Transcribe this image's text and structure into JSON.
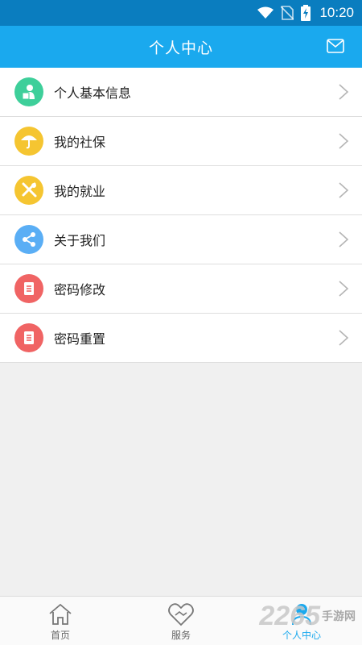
{
  "status": {
    "time": "10:20"
  },
  "header": {
    "title": "个人中心",
    "mail_icon": "mail-icon"
  },
  "menu": [
    {
      "label": "个人基本信息",
      "icon": "person-icon",
      "color": "#3ecf9a"
    },
    {
      "label": "我的社保",
      "icon": "umbrella-icon",
      "color": "#f5c531"
    },
    {
      "label": "我的就业",
      "icon": "tools-icon",
      "color": "#f5c531"
    },
    {
      "label": "关于我们",
      "icon": "share-icon",
      "color": "#5aaef5"
    },
    {
      "label": "密码修改",
      "icon": "document-icon",
      "color": "#f06464"
    },
    {
      "label": "密码重置",
      "icon": "document-icon",
      "color": "#f06464"
    }
  ],
  "tabs": [
    {
      "label": "首页",
      "icon": "home-icon"
    },
    {
      "label": "服务",
      "icon": "handshake-heart-icon"
    },
    {
      "label": "个人中心",
      "icon": "person-center-icon",
      "active": true
    }
  ],
  "watermark": {
    "text": "2265",
    "suffix": "手游网"
  },
  "colors": {
    "statusbar": "#0a7dbf",
    "appbar": "#1aa9ee",
    "accent": "#1aa9ee"
  }
}
